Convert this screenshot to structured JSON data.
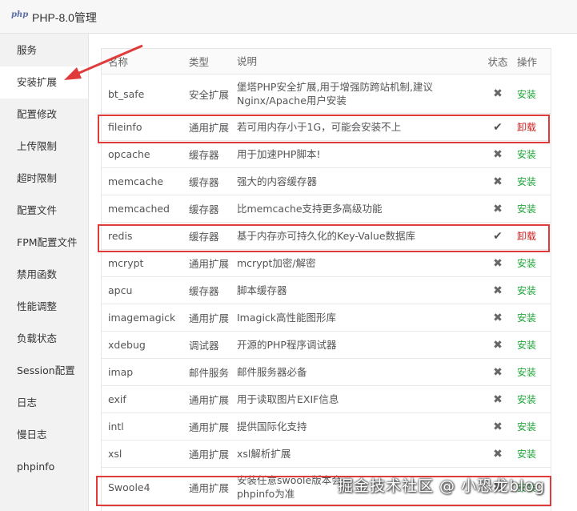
{
  "window": {
    "logo_text": "php",
    "title": "PHP-8.0管理"
  },
  "sidebar": {
    "items": [
      {
        "label": "服务"
      },
      {
        "label": "安装扩展"
      },
      {
        "label": "配置修改"
      },
      {
        "label": "上传限制"
      },
      {
        "label": "超时限制"
      },
      {
        "label": "配置文件"
      },
      {
        "label": "FPM配置文件"
      },
      {
        "label": "禁用函数"
      },
      {
        "label": "性能调整"
      },
      {
        "label": "负载状态"
      },
      {
        "label": "Session配置"
      },
      {
        "label": "日志"
      },
      {
        "label": "慢日志"
      },
      {
        "label": "phpinfo"
      }
    ]
  },
  "table": {
    "headers": {
      "name": "名称",
      "type": "类型",
      "desc": "说明",
      "status": "状态",
      "op": "操作"
    },
    "rows": [
      {
        "name": "bt_safe",
        "type": "安全扩展",
        "desc": "堡塔PHP安全扩展,用于增强防跨站机制,建议Nginx/Apache用户安装",
        "status": "✖",
        "op": "安装"
      },
      {
        "name": "fileinfo",
        "type": "通用扩展",
        "desc": "若可用内存小于1G，可能会安装不上",
        "status": "✔",
        "op": "卸载"
      },
      {
        "name": "opcache",
        "type": "缓存器",
        "desc": "用于加速PHP脚本!",
        "status": "✖",
        "op": "安装"
      },
      {
        "name": "memcache",
        "type": "缓存器",
        "desc": "强大的内容缓存器",
        "status": "✖",
        "op": "安装"
      },
      {
        "name": "memcached",
        "type": "缓存器",
        "desc": "比memcache支持更多高级功能",
        "status": "✖",
        "op": "安装"
      },
      {
        "name": "redis",
        "type": "缓存器",
        "desc": "基于内存亦可持久化的Key-Value数据库",
        "status": "✔",
        "op": "卸载"
      },
      {
        "name": "mcrypt",
        "type": "通用扩展",
        "desc": "mcrypt加密/解密",
        "status": "✖",
        "op": "安装"
      },
      {
        "name": "apcu",
        "type": "缓存器",
        "desc": "脚本缓存器",
        "status": "✖",
        "op": "安装"
      },
      {
        "name": "imagemagick",
        "type": "通用扩展",
        "desc": "Imagick高性能图形库",
        "status": "✖",
        "op": "安装"
      },
      {
        "name": "xdebug",
        "type": "调试器",
        "desc": "开源的PHP程序调试器",
        "status": "✖",
        "op": "安装"
      },
      {
        "name": "imap",
        "type": "邮件服务",
        "desc": "邮件服务器必备",
        "status": "✖",
        "op": "安装"
      },
      {
        "name": "exif",
        "type": "通用扩展",
        "desc": "用于读取图片EXIF信息",
        "status": "✖",
        "op": "安装"
      },
      {
        "name": "intl",
        "type": "通用扩展",
        "desc": "提供国际化支持",
        "status": "✖",
        "op": "安装"
      },
      {
        "name": "xsl",
        "type": "通用扩展",
        "desc": "xsl解析扩展",
        "status": "✖",
        "op": "安装"
      },
      {
        "name": "Swoole4",
        "type": "通用扩展",
        "desc": "安装任意swoole版本会",
        "desc2": "phpinfo为准",
        "status": "✖",
        "op": "安装"
      }
    ]
  },
  "watermark": "掘金技术社区 @ 小恐龙blog",
  "colors": {
    "install": "#20a53a",
    "uninstall": "#cc1f1f",
    "highlight": "#e03b3b"
  }
}
